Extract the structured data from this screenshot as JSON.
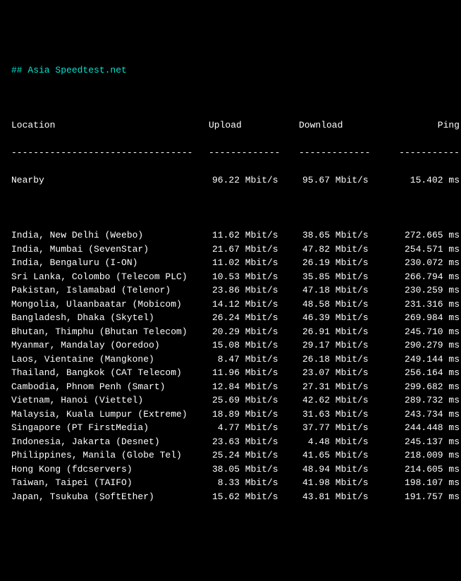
{
  "title": "## Asia Speedtest.net",
  "headers": {
    "location": "Location",
    "upload": "Upload",
    "download": "Download",
    "ping": "Ping"
  },
  "dividers": {
    "location": "---------------------------------",
    "upload": "-------------",
    "download": "-------------",
    "ping": "-----------"
  },
  "unit_speed": "Mbit/s",
  "unit_ping": "ms",
  "nearby": {
    "location": "Nearby",
    "upload": "96.22",
    "download": "95.67",
    "ping": "15.402"
  },
  "rows": [
    {
      "location": "India, New Delhi (Weebo)",
      "upload": "11.62",
      "download": "38.65",
      "ping": "272.665"
    },
    {
      "location": "India, Mumbai (SevenStar)",
      "upload": "21.67",
      "download": "47.82",
      "ping": "254.571"
    },
    {
      "location": "India, Bengaluru (I-ON)",
      "upload": "11.02",
      "download": "26.19",
      "ping": "230.072"
    },
    {
      "location": "Sri Lanka, Colombo (Telecom PLC)",
      "upload": "10.53",
      "download": "35.85",
      "ping": "266.794"
    },
    {
      "location": "Pakistan, Islamabad (Telenor)",
      "upload": "23.86",
      "download": "47.18",
      "ping": "230.259"
    },
    {
      "location": "Mongolia, Ulaanbaatar (Mobicom)",
      "upload": "14.12",
      "download": "48.58",
      "ping": "231.316"
    },
    {
      "location": "Bangladesh, Dhaka (Skytel)",
      "upload": "26.24",
      "download": "46.39",
      "ping": "269.984"
    },
    {
      "location": "Bhutan, Thimphu (Bhutan Telecom)",
      "upload": "20.29",
      "download": "26.91",
      "ping": "245.710"
    },
    {
      "location": "Myanmar, Mandalay (Ooredoo)",
      "upload": "15.08",
      "download": "29.17",
      "ping": "290.279"
    },
    {
      "location": "Laos, Vientaine (Mangkone)",
      "upload": "8.47",
      "download": "26.18",
      "ping": "249.144"
    },
    {
      "location": "Thailand, Bangkok (CAT Telecom)",
      "upload": "11.96",
      "download": "23.07",
      "ping": "256.164"
    },
    {
      "location": "Cambodia, Phnom Penh (Smart)",
      "upload": "12.84",
      "download": "27.31",
      "ping": "299.682"
    },
    {
      "location": "Vietnam, Hanoi (Viettel)",
      "upload": "25.69",
      "download": "42.62",
      "ping": "289.732"
    },
    {
      "location": "Malaysia, Kuala Lumpur (Extreme)",
      "upload": "18.89",
      "download": "31.63",
      "ping": "243.734"
    },
    {
      "location": "Singapore (PT FirstMedia)",
      "upload": "4.77",
      "download": "37.77",
      "ping": "244.448"
    },
    {
      "location": "Indonesia, Jakarta (Desnet)",
      "upload": "23.63",
      "download": "4.48",
      "ping": "245.137"
    },
    {
      "location": "Philippines, Manila (Globe Tel)",
      "upload": "25.24",
      "download": "41.65",
      "ping": "218.009"
    },
    {
      "location": "Hong Kong (fdcservers)",
      "upload": "38.05",
      "download": "48.94",
      "ping": "214.605"
    },
    {
      "location": "Taiwan, Taipei (TAIFO)",
      "upload": "8.33",
      "download": "41.98",
      "ping": "198.107"
    },
    {
      "location": "Japan, Tsukuba (SoftEther)",
      "upload": "15.62",
      "download": "43.81",
      "ping": "191.757"
    }
  ]
}
